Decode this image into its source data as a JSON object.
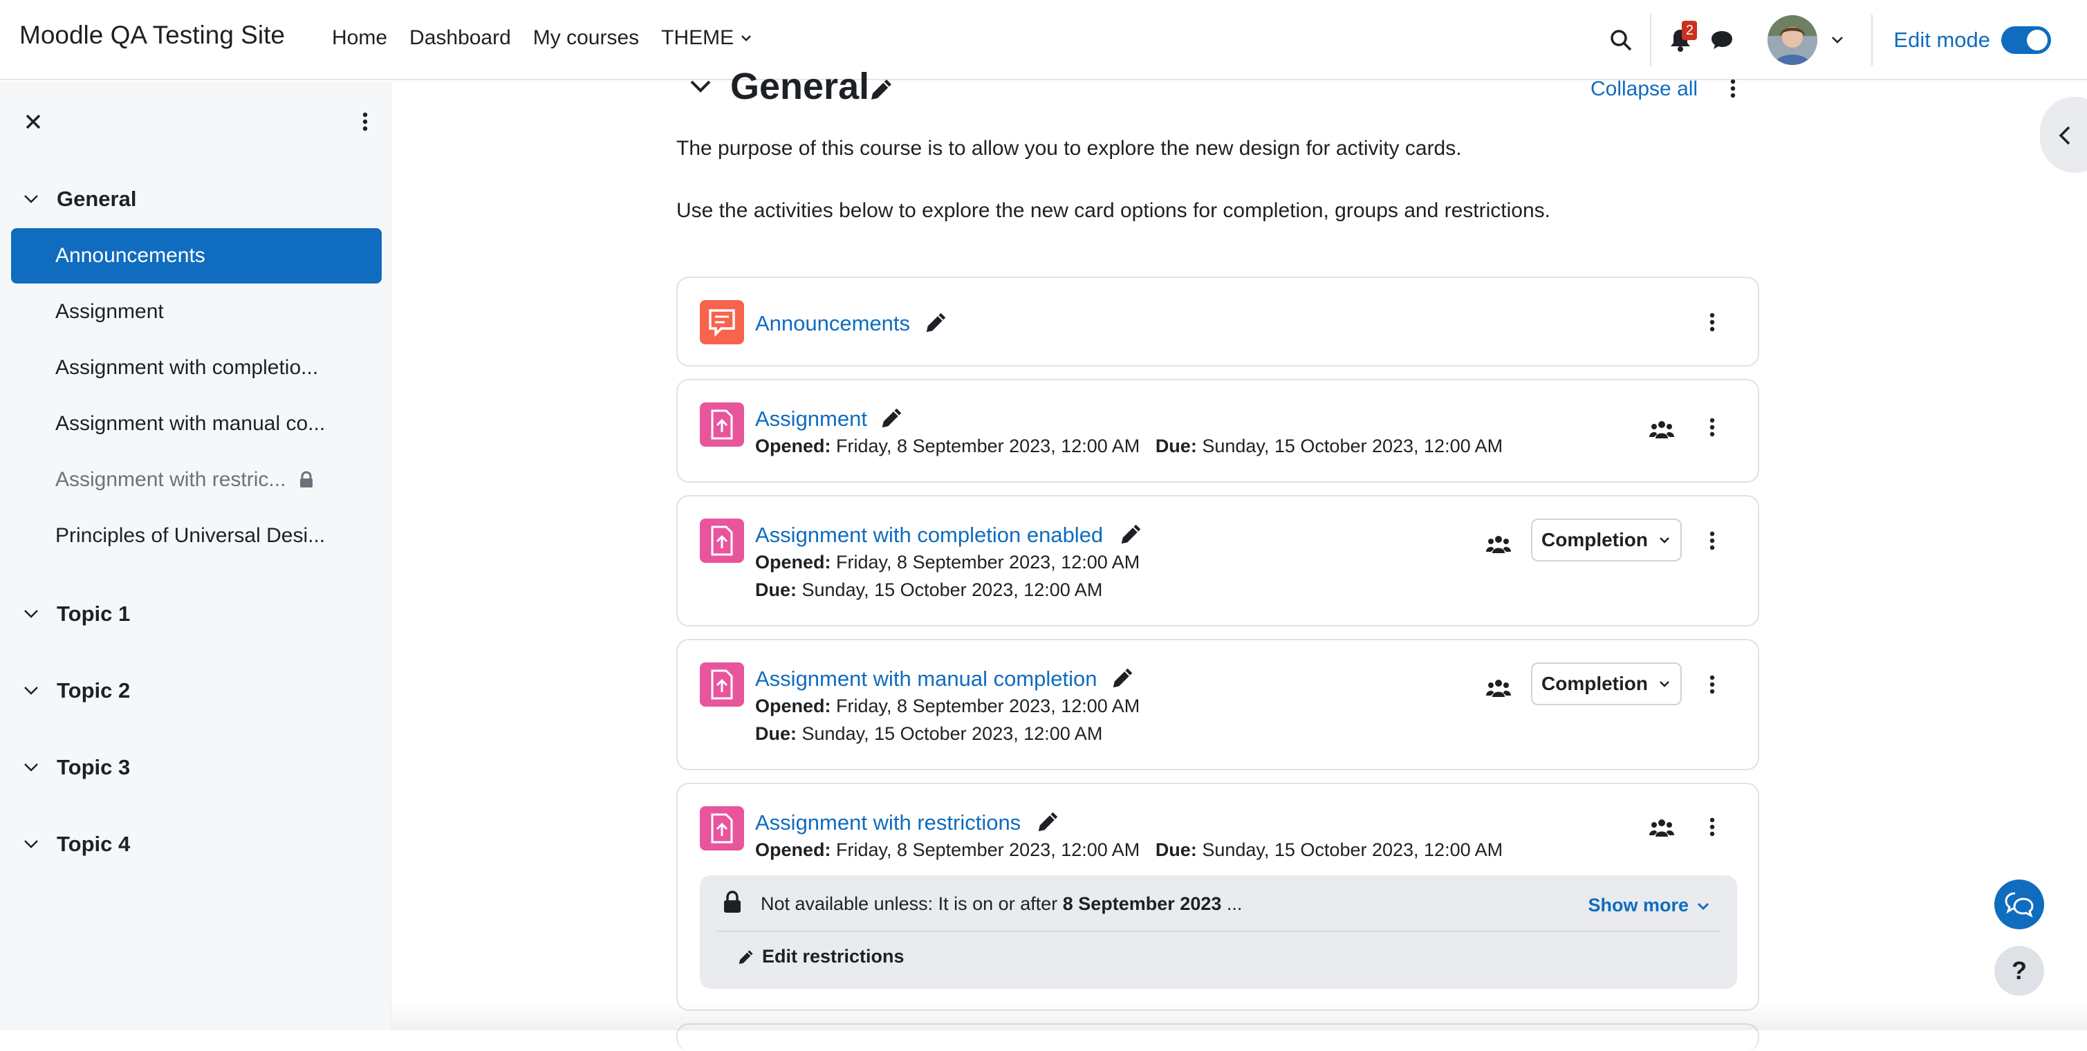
{
  "navbar": {
    "site_name": "Moodle QA Testing Site",
    "links": [
      "Home",
      "Dashboard",
      "My courses",
      "THEME"
    ],
    "notification_count": "2",
    "edit_mode_label": "Edit mode",
    "edit_mode_on": true
  },
  "sidebar": {
    "sections": [
      {
        "label": "General",
        "items": [
          {
            "label": "Announcements",
            "active": true
          },
          {
            "label": "Assignment"
          },
          {
            "label": "Assignment with completio..."
          },
          {
            "label": "Assignment with manual co..."
          },
          {
            "label": "Assignment with restric...",
            "restricted": true
          },
          {
            "label": "Principles of Universal Desi..."
          }
        ]
      },
      {
        "label": "Topic 1"
      },
      {
        "label": "Topic 2"
      },
      {
        "label": "Topic 3"
      },
      {
        "label": "Topic 4"
      }
    ]
  },
  "main": {
    "section_title": "General",
    "collapse_all": "Collapse all",
    "summary": [
      "The purpose of this course is to allow you to explore the new design for activity cards.",
      "Use the activities below to explore the new card options for completion, groups and restrictions."
    ],
    "activities": [
      {
        "title": "Announcements",
        "type": "forum"
      },
      {
        "title": "Assignment",
        "opened_label": "Opened:",
        "opened": "Friday, 8 September 2023, 12:00 AM",
        "due_label": "Due:",
        "due": "Sunday, 15 October 2023, 12:00 AM"
      },
      {
        "title": "Assignment with completion enabled",
        "opened_label": "Opened:",
        "opened": "Friday, 8 September 2023, 12:00 AM",
        "due_label": "Due:",
        "due": "Sunday, 15 October 2023, 12:00 AM",
        "completion": "Completion"
      },
      {
        "title": "Assignment with manual completion",
        "opened_label": "Opened:",
        "opened": "Friday, 8 September 2023, 12:00 AM",
        "due_label": "Due:",
        "due": "Sunday, 15 October 2023, 12:00 AM",
        "completion": "Completion"
      },
      {
        "title": "Assignment with restrictions",
        "opened_label": "Opened:",
        "opened": "Friday, 8 September 2023, 12:00 AM",
        "due_label": "Due:",
        "due": "Sunday, 15 October 2023, 12:00 AM",
        "restriction_prefix": "Not available unless: It is on or after ",
        "restriction_date": "8 September 2023",
        "restriction_suffix": " ...",
        "show_more": "Show more",
        "edit_restrictions": "Edit restrictions"
      }
    ]
  },
  "help_label": "?",
  "colors": {
    "accent": "#0f6cbf",
    "forum": "#f7634d",
    "assign": "#e8559c"
  }
}
